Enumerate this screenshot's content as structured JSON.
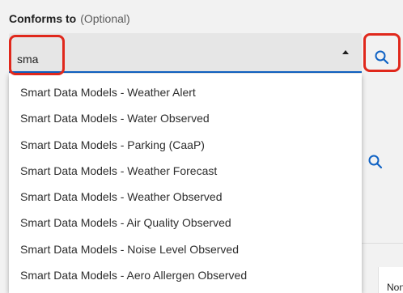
{
  "field": {
    "label": "Conforms to",
    "optional": "(Optional)",
    "input_value": "sma"
  },
  "dropdown": {
    "options": [
      "Smart Data Models - Weather Alert",
      "Smart Data Models - Water Observed",
      "Smart Data Models - Parking (CaaP)",
      "Smart Data Models - Weather Forecast",
      "Smart Data Models - Weather Observed",
      "Smart Data Models - Air Quality Observed",
      "Smart Data Models - Noise Level Observed",
      "Smart Data Models - Aero Allergen Observed"
    ]
  },
  "background": {
    "card_text": "Non",
    "map_zoom_in": "+"
  },
  "icons": {
    "search": "search-icon",
    "caret": "caret-up-icon",
    "location": "map-pin-icon",
    "box": "square-icon"
  },
  "colors": {
    "accent": "#0f62c4",
    "highlight": "#e0281c",
    "field_bg": "#e6e6e6"
  }
}
